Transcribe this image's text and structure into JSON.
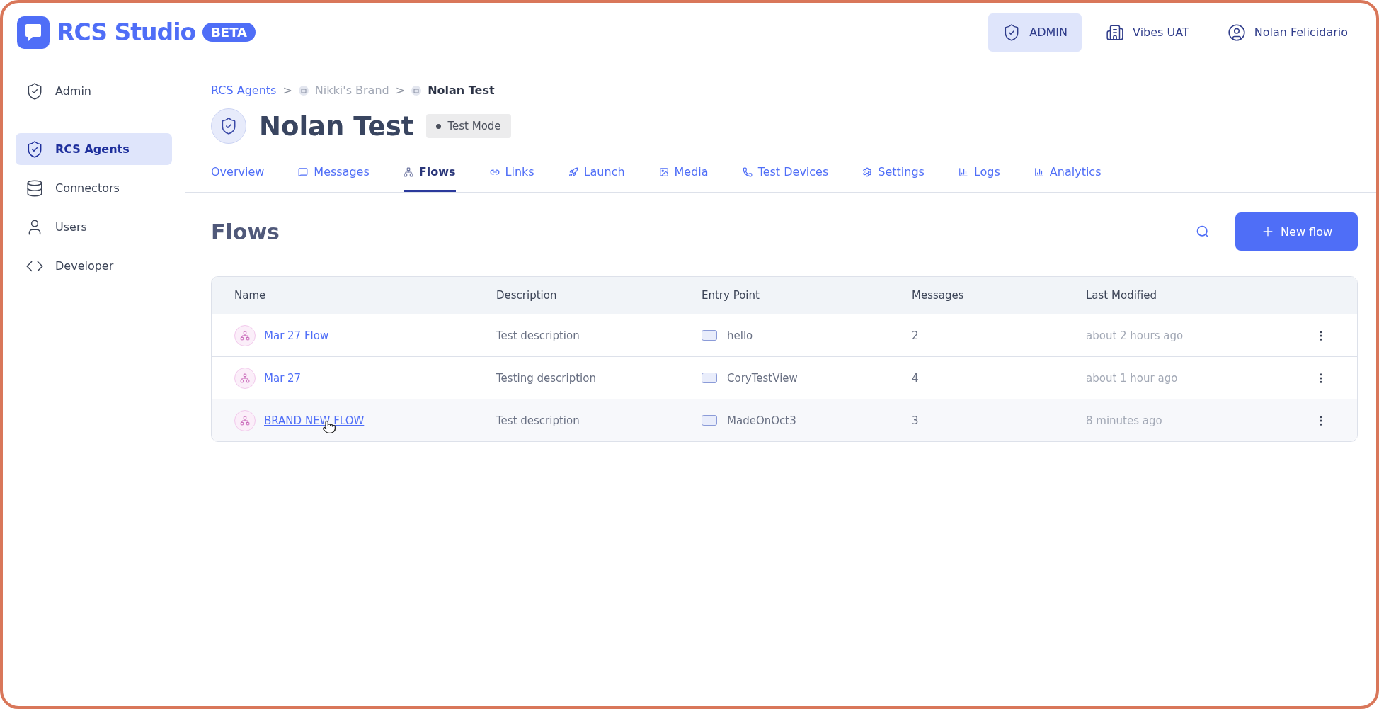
{
  "header": {
    "logo_text": "RCS Studio",
    "badge": "BETA",
    "actions": [
      {
        "label": "ADMIN",
        "kind": "shield",
        "selected": true
      },
      {
        "label": "Vibes UAT",
        "kind": "building",
        "selected": false
      },
      {
        "label": "Nolan Felicidario",
        "kind": "user",
        "selected": false
      }
    ]
  },
  "sidebar": {
    "top": [
      {
        "label": "Admin",
        "kind": "shield",
        "selected": false
      }
    ],
    "items": [
      {
        "label": "RCS Agents",
        "kind": "agent",
        "selected": true
      },
      {
        "label": "Connectors",
        "kind": "database",
        "selected": false
      },
      {
        "label": "Users",
        "kind": "user",
        "selected": false
      },
      {
        "label": "Developer",
        "kind": "code",
        "selected": false
      }
    ]
  },
  "breadcrumb": {
    "separator": ">",
    "items": [
      {
        "label": "RCS Agents",
        "kind": "link"
      },
      {
        "label": "Nikki's Brand",
        "kind": "brand"
      },
      {
        "label": "Nolan Test",
        "kind": "current"
      }
    ]
  },
  "agent": {
    "title": "Nolan Test",
    "mode": "Test Mode"
  },
  "tabs": [
    {
      "label": "Overview",
      "kind": "none",
      "selected": false
    },
    {
      "label": "Messages",
      "kind": "chat",
      "selected": false
    },
    {
      "label": "Flows",
      "kind": "flow",
      "selected": true
    },
    {
      "label": "Links",
      "kind": "link",
      "selected": false
    },
    {
      "label": "Launch",
      "kind": "rocket",
      "selected": false
    },
    {
      "label": "Media",
      "kind": "image",
      "selected": false
    },
    {
      "label": "Test Devices",
      "kind": "phone",
      "selected": false
    },
    {
      "label": "Settings",
      "kind": "gear",
      "selected": false
    },
    {
      "label": "Logs",
      "kind": "bars",
      "selected": false
    },
    {
      "label": "Analytics",
      "kind": "bars",
      "selected": false
    }
  ],
  "section": {
    "title": "Flows",
    "new_button": "New flow"
  },
  "table": {
    "columns": [
      "Name",
      "Description",
      "Entry Point",
      "Messages",
      "Last Modified"
    ],
    "rows": [
      {
        "name": "Mar 27 Flow",
        "description": "Test description",
        "entry_point": "hello",
        "messages": "2",
        "last_modified": "about 2 hours ago",
        "hovered": false
      },
      {
        "name": "Mar 27",
        "description": "Testing description",
        "entry_point": "CoryTestView",
        "messages": "4",
        "last_modified": "about 1 hour ago",
        "hovered": false
      },
      {
        "name": "BRAND NEW FLOW",
        "description": "Test description",
        "entry_point": "MadeOnOct3",
        "messages": "3",
        "last_modified": "8 minutes ago",
        "hovered": true
      }
    ]
  }
}
